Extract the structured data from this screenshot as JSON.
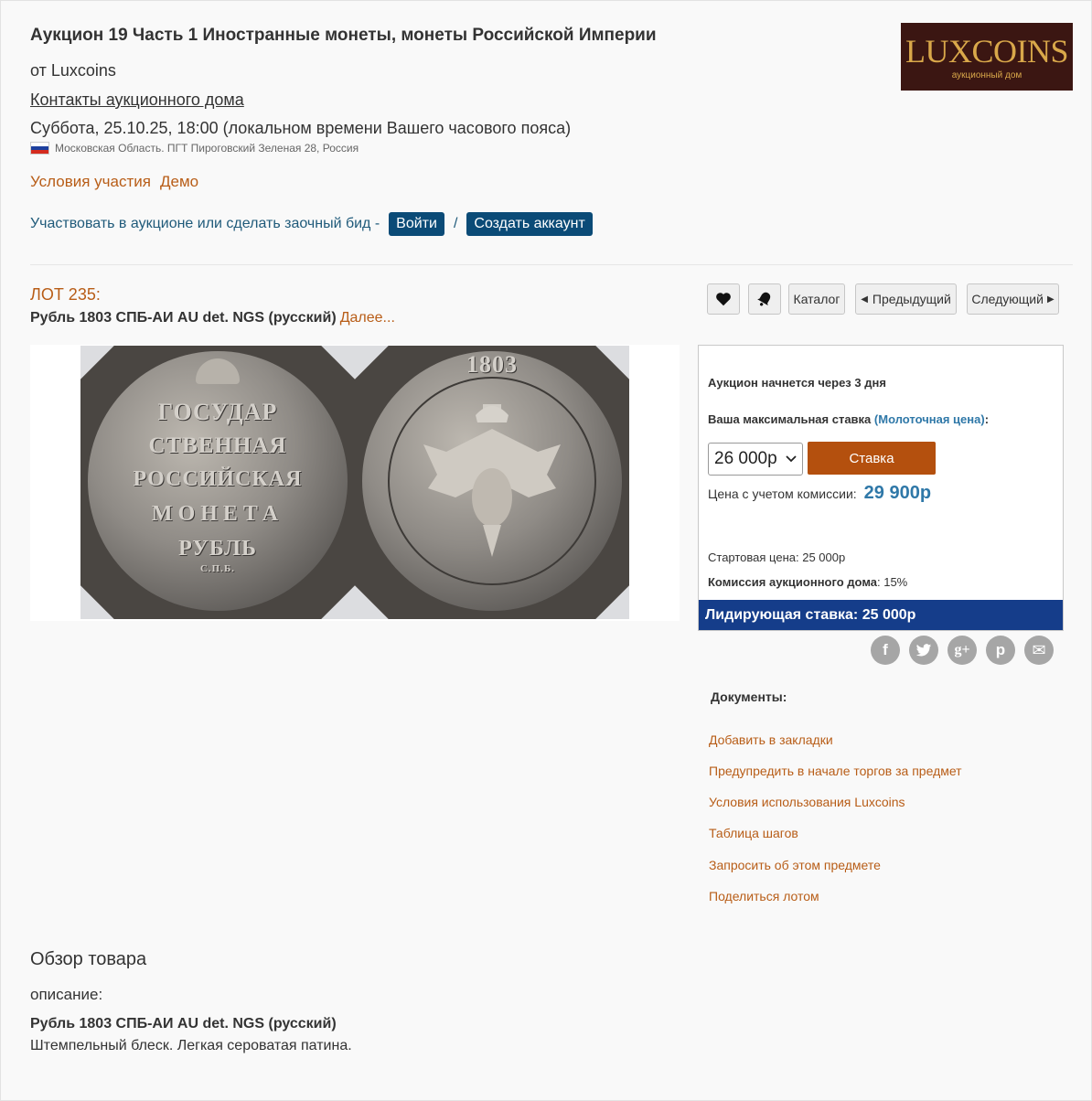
{
  "header": {
    "title": "Аукцион 19 Часть 1 Иностранные монеты, монеты Российской Империи",
    "house": "от Luxcoins",
    "contacts": "Контакты аукционного дома",
    "date": "Суббота, 25.10.25, 18:00 (локальном времени Вашего часового пояса)",
    "location": "Московская Область. ПГТ Пироговский Зеленая 28, Россия",
    "terms": "Условия участия",
    "demo": "Демо",
    "participate": "Участвовать в аукционе или сделать заочный бид -",
    "login": "Войти",
    "separator": "/",
    "register": "Создать аккаунт"
  },
  "logo": {
    "main": "LUXCOINS",
    "sub": "аукционный дом"
  },
  "lot": {
    "number": "ЛОТ 235:",
    "title": "Рубль 1803 СПБ-АИ AU det. NGS (русский)",
    "more": "Далее..."
  },
  "nav": {
    "catalog": "Каталог",
    "previous": "Предыдущий",
    "next": "Следующий",
    "favorite_icon": "heart-icon",
    "alert_icon": "bell-icon"
  },
  "coin_image": {
    "obverse": [
      "ГОСУДАР",
      "СТВЕННАЯ",
      "РОССИЙСКАЯ",
      "МОНЕТА",
      "РУБЛЬ",
      "С.П.Б."
    ],
    "reverse": "1803"
  },
  "bid": {
    "starts_in": "Аукцион начнется через 3 дня",
    "max_bid_label": "Ваша максимальная ставка",
    "hammer_label": "(Молоточная цена)",
    "colon": ":",
    "selected_value": "26 000р",
    "bid_button": "Ставка",
    "commission_price_label": "Цена с учетом комиссии:",
    "commission_price_value": "29 900р",
    "start_price": "Стартовая цена: 25 000р",
    "house_fee_label": "Комиссия аукционного дома",
    "house_fee_value": ": 15%",
    "leading_bid": "Лидирующая ставка: 25 000р"
  },
  "share": [
    "f",
    "t",
    "g+",
    "p",
    "✉"
  ],
  "documents": {
    "title": "Документы:",
    "links": [
      "Добавить в закладки",
      "Предупредить в начале торгов за предмет",
      "Условия использования Luxcoins",
      "Таблица шагов",
      "Запросить об этом предмете",
      "Поделиться лотом"
    ]
  },
  "overview": {
    "title": "Обзор товара",
    "desc_label": "описание:",
    "desc_title": "Рубль 1803 СПБ-АИ AU det. NGS (русский)",
    "desc_text": "Штемпельный блеск. Легкая сероватая патина."
  },
  "colors": {
    "accent_orange": "#b85d17",
    "navy_button": "#0b4b77",
    "bid_button": "#b4500e",
    "leading_bar": "#153d8a",
    "price_blue": "#2f78a8"
  }
}
